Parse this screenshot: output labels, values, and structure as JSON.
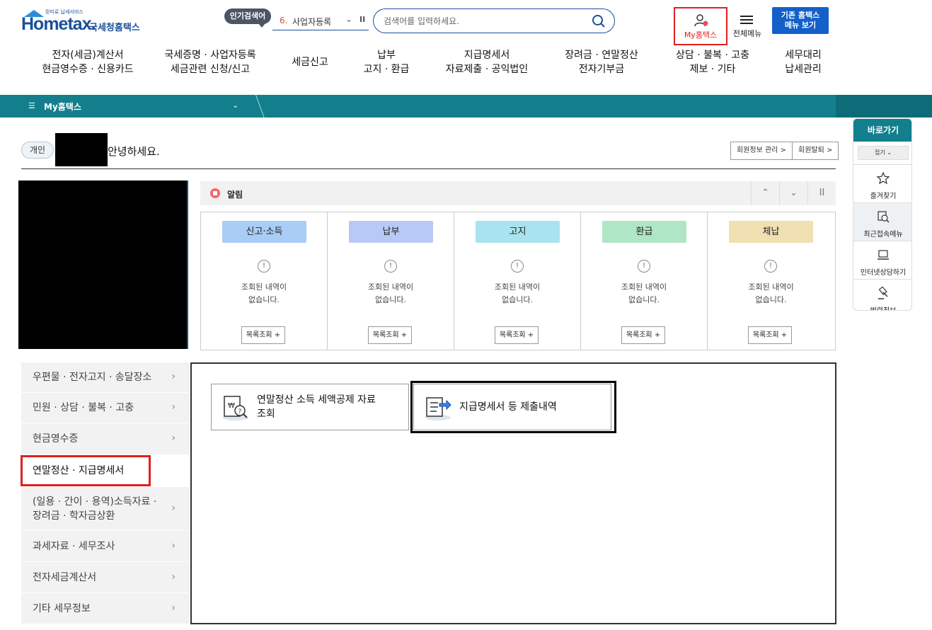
{
  "header": {
    "logo_tag": "믿미로 납세서비스",
    "logo_home": "Home",
    "logo_tax": "tax.",
    "logo_korean": "국세청홈택스",
    "popular_label": "인기검색어",
    "popular_rank": "6.",
    "popular_term": "사업자등록",
    "search_placeholder": "검색어를 입력하세요.",
    "my_hometax": "My홈택스",
    "all_menu": "전체메뉴",
    "legacy_line1": "기존 홈택스",
    "legacy_line2": "메뉴 보기"
  },
  "nav": [
    {
      "line1": "전자(세금)계산서",
      "line2": "현금영수증 · 신용카드"
    },
    {
      "line1": "국세증명 · 사업자등록",
      "line2": "세금관련 신청/신고"
    },
    {
      "line1": "세금신고",
      "line2": ""
    },
    {
      "line1": "납부",
      "line2": "고지 · 환급"
    },
    {
      "line1": "지급명세서",
      "line2": "자료제출 · 공익법인"
    },
    {
      "line1": "장려금 · 연말정산",
      "line2": "전자기부금"
    },
    {
      "line1": "상담 · 불복 · 고충",
      "line2": "제보 · 기타"
    },
    {
      "line1": "세무대리",
      "line2": "납세관리"
    }
  ],
  "breadcrumb": {
    "label": "My홈택스"
  },
  "greeting": {
    "type_badge": "개인",
    "text": "안녕하세요.",
    "member_info": "회원정보 관리 >",
    "withdraw": "회원탈퇴 >"
  },
  "notice": {
    "label": "알림"
  },
  "status": [
    {
      "title": "신고·소득",
      "color": "#a9cdf4",
      "msg": "조회된 내역이\n없습니다.",
      "more": "목록조회 +"
    },
    {
      "title": "납부",
      "color": "#b9c9f5",
      "msg": "조회된 내역이\n없습니다.",
      "more": "목록조회 +"
    },
    {
      "title": "고지",
      "color": "#a8e3ef",
      "msg": "조회된 내역이\n없습니다.",
      "more": "목록조회 +"
    },
    {
      "title": "환급",
      "color": "#aee6c6",
      "msg": "조회된 내역이\n없습니다.",
      "more": "목록조회 +"
    },
    {
      "title": "체납",
      "color": "#f1e0b1",
      "msg": "조회된 내역이\n없습니다.",
      "more": "목록조회 +"
    }
  ],
  "side_menu": [
    "우편물 · 전자고지 · 송달장소",
    "민원 · 상담 · 불복 · 고충",
    "현금영수증",
    "연말정산 · 지급명세서",
    "(일용 · 간이 · 용역)소득자료 ·\n장려금 · 학자금상환",
    "과세자료 · 세무조사",
    "전자세금계산서",
    "기타 세무정보"
  ],
  "content_cards": [
    {
      "label": "연말정산 소득 세액공제 자료\n조회"
    },
    {
      "label": "지급명세서 등 제출내역"
    }
  ],
  "quick": {
    "title": "바로가기",
    "fold": "접기",
    "items": [
      "즐겨찾기",
      "최근접속메뉴",
      "인터넷상담하기",
      "법령정보"
    ]
  }
}
